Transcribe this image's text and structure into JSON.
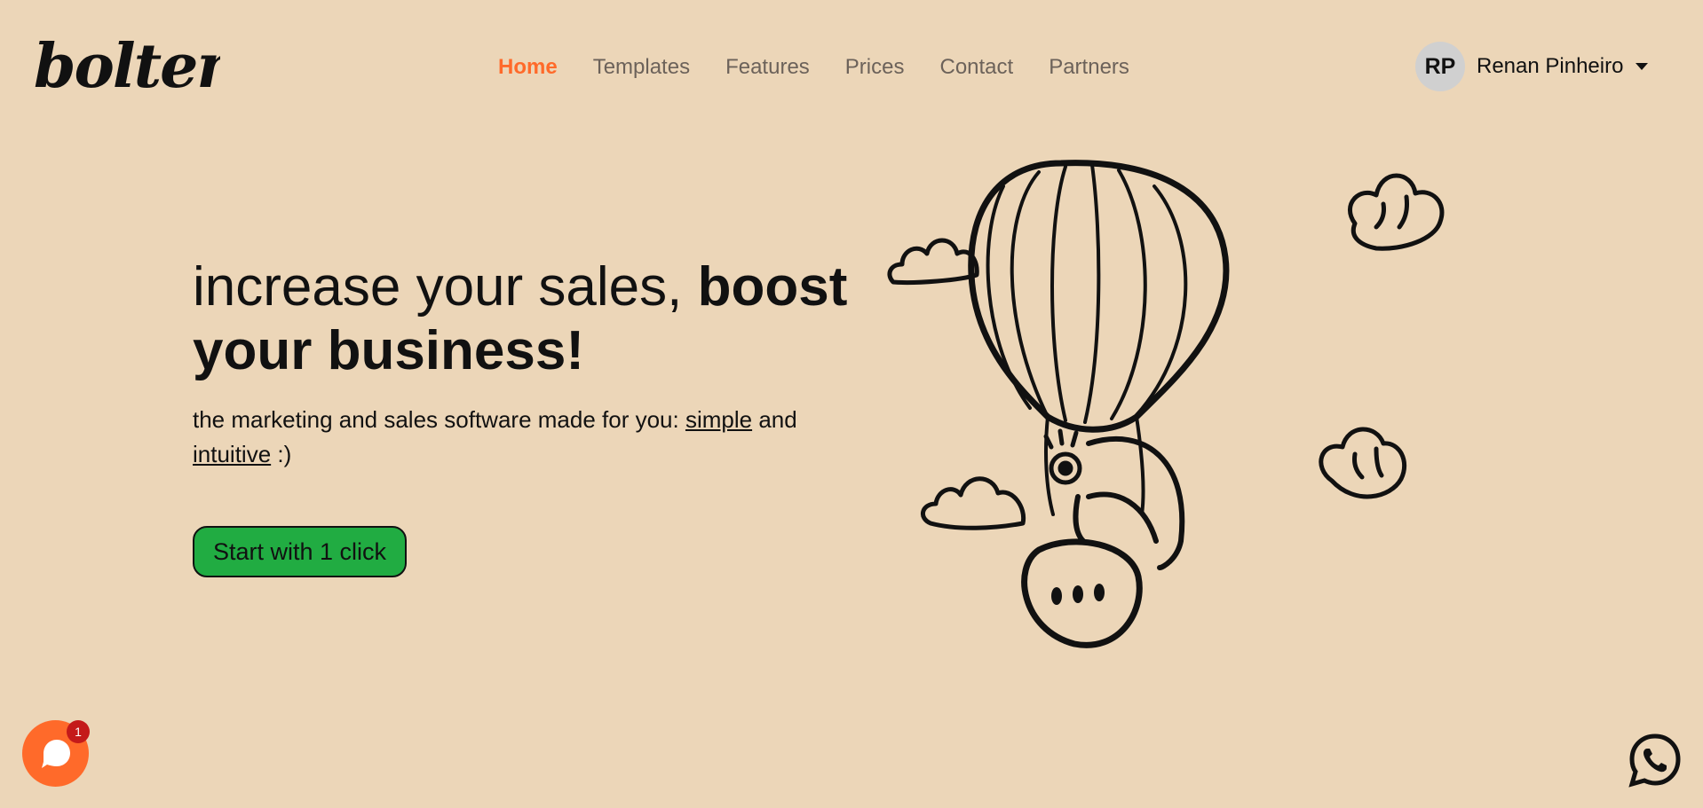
{
  "brand": {
    "logo_text": "bolten",
    "accent": "#ff6a2a"
  },
  "nav": {
    "items": [
      {
        "label": "Home",
        "active": true
      },
      {
        "label": "Templates",
        "active": false
      },
      {
        "label": "Features",
        "active": false
      },
      {
        "label": "Prices",
        "active": false
      },
      {
        "label": "Contact",
        "active": false
      },
      {
        "label": "Partners",
        "active": false
      }
    ]
  },
  "user": {
    "initials": "RP",
    "name": "Renan Pinheiro"
  },
  "hero": {
    "title_regular": "increase your sales, ",
    "title_bold": "boost your business!",
    "subtitle_before": "the marketing and sales software made for you: ",
    "subtitle_link1": "simple",
    "subtitle_middle": " and ",
    "subtitle_link2": "intuitive",
    "subtitle_after": " :)",
    "cta_label": "Start with 1 click",
    "cta_color": "#21ac42"
  },
  "chat": {
    "badge_count": "1",
    "icon": "chat-bubble-icon"
  },
  "whatsapp": {
    "icon": "whatsapp-icon"
  },
  "background": "#ecd6b8"
}
